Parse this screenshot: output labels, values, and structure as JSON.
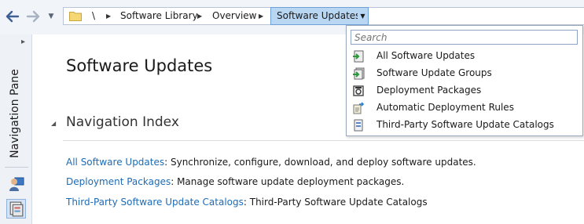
{
  "toolbar": {
    "back_icon": "back-arrow-icon",
    "forward_icon": "forward-arrow-icon",
    "history_icon": "dropdown-arrow-icon"
  },
  "breadcrumb": {
    "root": "\\",
    "items": [
      "Software Library",
      "Overview",
      "Software Updates"
    ],
    "folder_icon": "folder-icon"
  },
  "navpane": {
    "label": "Navigation Pane"
  },
  "main": {
    "title": "Software Updates",
    "section_title": "Navigation Index",
    "items": [
      {
        "link": "All Software Updates",
        "text": ": Synchronize, configure, download, and deploy software updates."
      },
      {
        "link": "Deployment Packages",
        "text": ": Manage software update deployment packages."
      },
      {
        "link": "Third-Party Software Update Catalogs",
        "text": ": Third-Party Software Update Catalogs"
      }
    ]
  },
  "dropdown": {
    "search_placeholder": "Search",
    "items": [
      {
        "label": "All Software Updates",
        "icon": "software-updates-icon"
      },
      {
        "label": "Software Update Groups",
        "icon": "update-groups-icon"
      },
      {
        "label": "Deployment Packages",
        "icon": "deployment-packages-icon"
      },
      {
        "label": "Automatic Deployment Rules",
        "icon": "deployment-rules-icon"
      },
      {
        "label": "Third-Party Software Update Catalogs",
        "icon": "catalog-icon"
      }
    ]
  },
  "colors": {
    "link": "#1c6bb7",
    "active_crumb": "#b9d7f3",
    "topbar": "#f1f4f9"
  }
}
